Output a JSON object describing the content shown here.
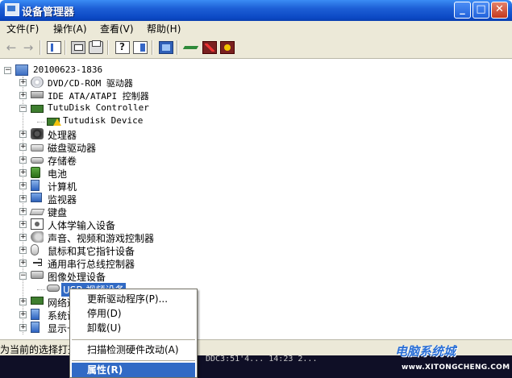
{
  "window": {
    "title": "设备管理器"
  },
  "titlebar_buttons": {
    "minimize": "_",
    "maximize": "□",
    "close": "✕"
  },
  "menu": {
    "items": [
      "文件(F)",
      "操作(A)",
      "查看(V)",
      "帮助(H)"
    ]
  },
  "toolbar": {
    "icons": [
      "back-icon",
      "forward-icon",
      "show-hide-tree-icon",
      "properties-icon",
      "print-icon",
      "help-icon",
      "show-hide-action-pane-icon",
      "scan-hardware-icon",
      "update-driver-icon",
      "uninstall-icon",
      "disable-icon"
    ],
    "back_glyph": "←",
    "forward_glyph": "→"
  },
  "tree": {
    "root": "20100623-1836",
    "items": [
      {
        "label": "DVD/CD-ROM 驱动器",
        "icon": "cdrom-icon",
        "expanded": false
      },
      {
        "label": "IDE ATA/ATAPI 控制器",
        "icon": "ide-controller-icon",
        "expanded": false
      },
      {
        "label": "TutuDisk Controller",
        "icon": "disk-controller-icon",
        "expanded": true,
        "children": [
          {
            "label": "Tutudisk Device",
            "icon": "warning-device-icon"
          }
        ]
      },
      {
        "label": "处理器",
        "icon": "processor-icon",
        "expanded": false
      },
      {
        "label": "磁盘驱动器",
        "icon": "disk-drive-icon",
        "expanded": false
      },
      {
        "label": "存储卷",
        "icon": "storage-volume-icon",
        "expanded": false
      },
      {
        "label": "电池",
        "icon": "battery-icon",
        "expanded": false
      },
      {
        "label": "计算机",
        "icon": "computer-icon",
        "expanded": false
      },
      {
        "label": "监视器",
        "icon": "monitor-icon",
        "expanded": false
      },
      {
        "label": "键盘",
        "icon": "keyboard-icon",
        "expanded": false
      },
      {
        "label": "人体学输入设备",
        "icon": "hid-icon",
        "expanded": false
      },
      {
        "label": "声音、视频和游戏控制器",
        "icon": "sound-icon",
        "expanded": false
      },
      {
        "label": "鼠标和其它指针设备",
        "icon": "mouse-icon",
        "expanded": false
      },
      {
        "label": "通用串行总线控制器",
        "icon": "usb-icon",
        "expanded": false
      },
      {
        "label": "图像处理设备",
        "icon": "imaging-icon",
        "expanded": true,
        "children": [
          {
            "label": "USB 视频设备",
            "icon": "camera-icon",
            "selected": true
          }
        ]
      },
      {
        "label": "网络适",
        "icon": "network-icon",
        "expanded": false
      },
      {
        "label": "系统设",
        "icon": "system-icon",
        "expanded": false
      },
      {
        "label": "显示卡",
        "icon": "display-icon",
        "expanded": false
      }
    ]
  },
  "context_menu": {
    "items": [
      {
        "label": "更新驱动程序(P)..."
      },
      {
        "label": "停用(D)"
      },
      {
        "label": "卸载(U)"
      },
      {
        "label": "扫描检测硬件改动(A)"
      },
      {
        "label": "属性(R)",
        "highlighted": true
      }
    ]
  },
  "statusbar": {
    "text": "为当前的选择打开"
  },
  "background_text": "DDC3:51'4...    14:23 2...",
  "watermark": {
    "title": "电脑系统城",
    "url": "www.XITONGCHENG.COM"
  }
}
